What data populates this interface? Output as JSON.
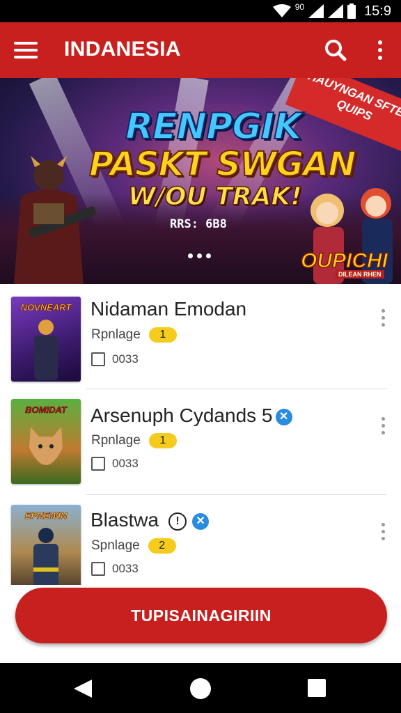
{
  "status_bar": {
    "network": "90",
    "clock": "15:9"
  },
  "app_bar": {
    "title": "INDANESIA",
    "icons": [
      "menu-icon",
      "search-icon",
      "more-vert-icon"
    ]
  },
  "banner": {
    "line1": "RENPGIK",
    "line2": "PASKT SWGAN",
    "line3": "W/OU TRAK!",
    "price": "RRS: 6B8",
    "ribbon": "HAUYNGAN SFTER QUIPS",
    "logo": "OUPICHI",
    "logo_sub": "DILEAN RHEN"
  },
  "games": [
    {
      "thumb_caption": "NOVNEART",
      "title": "Nidaman Emodan",
      "category": "Rpnlage",
      "badge": "1",
      "code": "0033",
      "verified": false,
      "info": false,
      "thumb_color": "#5a2a9a"
    },
    {
      "thumb_caption": "BOMIDAT",
      "title": "Arsenuph Cydands 5",
      "category": "Rpnlage",
      "badge": "1",
      "code": "0033",
      "verified": true,
      "info": false,
      "thumb_color": "#3a7a2a"
    },
    {
      "thumb_caption": "EPNEWIN",
      "title": "Blastwa",
      "category": "Spnlage",
      "badge": "2",
      "code": "0033",
      "verified": true,
      "info": true,
      "thumb_color": "#3a5a8a"
    }
  ],
  "cta": {
    "label": "TUPISAINAGIRIIN"
  },
  "colors": {
    "primary": "#c8201f",
    "badge": "#f5cc1e",
    "verified": "#2a8ce0"
  }
}
